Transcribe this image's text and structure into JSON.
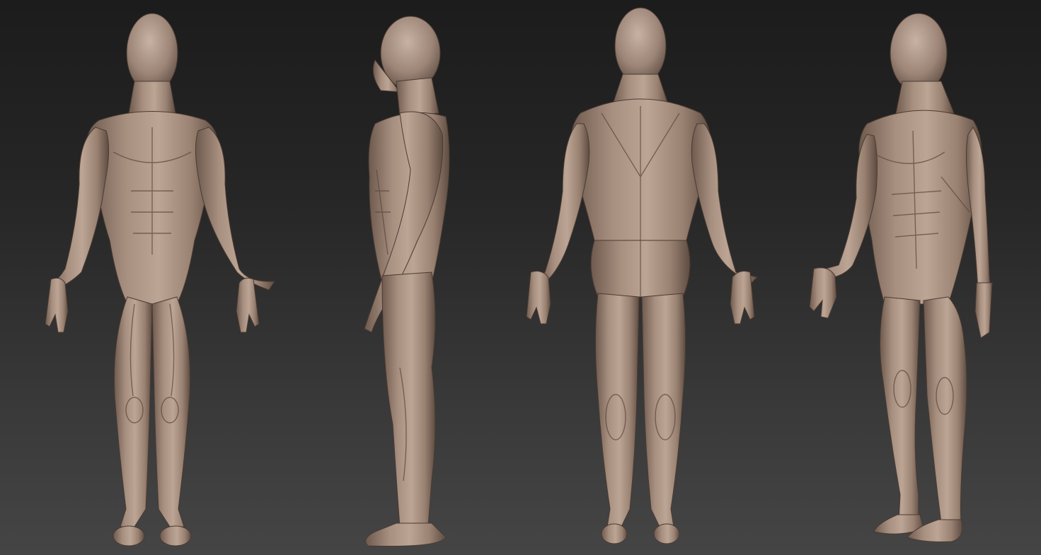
{
  "scene": {
    "background_top": "#1c1c1c",
    "background_bottom": "#454545",
    "skin_color": "#9c8577",
    "skin_highlight": "#c7b2a3",
    "skin_shadow": "#5e4c42",
    "views": [
      {
        "name": "front-view"
      },
      {
        "name": "side-view"
      },
      {
        "name": "back-view"
      },
      {
        "name": "three-quarter-view"
      }
    ]
  }
}
